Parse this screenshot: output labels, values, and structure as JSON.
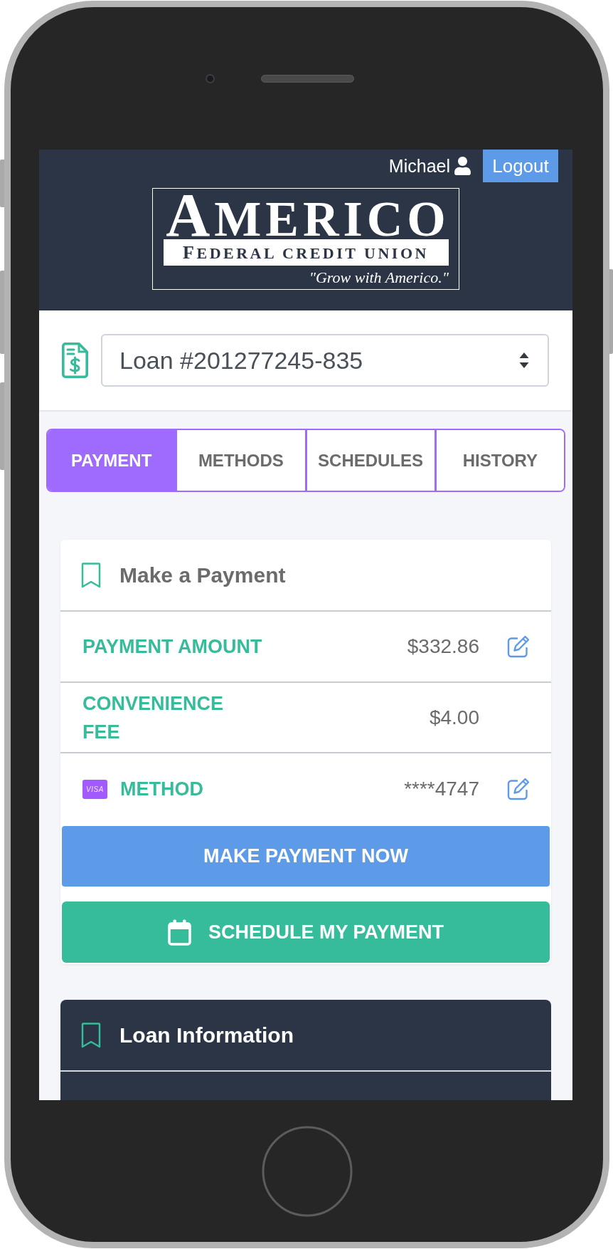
{
  "header": {
    "user_name": "Michael",
    "logout_label": "Logout",
    "logo": {
      "name": "AMERICO",
      "subtitle": "FEDERAL CREDIT UNION",
      "tagline": "\"Grow with Americo.\""
    }
  },
  "loan_select": {
    "value": "Loan #201277245-835"
  },
  "tabs": [
    {
      "label": "PAYMENT",
      "selected": true
    },
    {
      "label": "METHODS",
      "selected": false
    },
    {
      "label": "SCHEDULES",
      "selected": false
    },
    {
      "label": "HISTORY",
      "selected": false
    }
  ],
  "payment_card": {
    "title": "Make a Payment",
    "rows": [
      {
        "label": "PAYMENT AMOUNT",
        "value": "$332.86",
        "editable": true
      },
      {
        "label": "CONVENIENCE FEE",
        "value": "$4.00",
        "editable": false
      },
      {
        "label": "METHOD",
        "value": "****4747",
        "editable": true,
        "card_brand": "VISA"
      }
    ],
    "buttons": [
      {
        "label": "MAKE PAYMENT NOW",
        "kind": "primary"
      },
      {
        "label": "SCHEDULE MY PAYMENT",
        "kind": "schedule"
      }
    ]
  },
  "loan_info_card": {
    "title": "Loan Information"
  }
}
